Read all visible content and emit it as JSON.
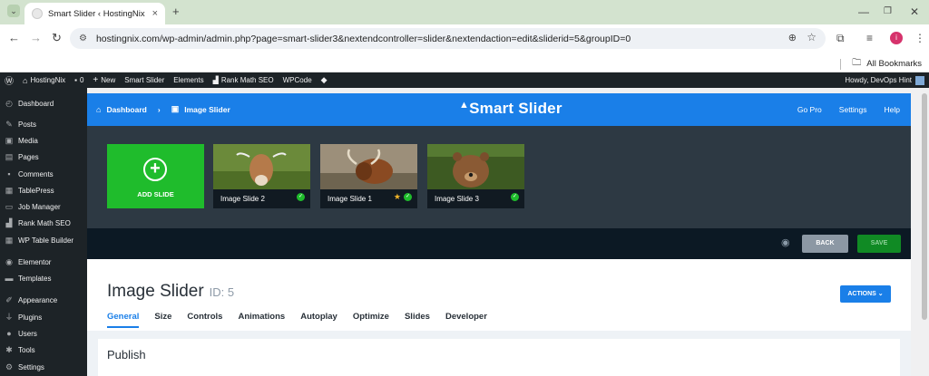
{
  "browser": {
    "tab_title": "Smart Slider ‹ HostingNix — W",
    "tab_close": "×",
    "new_tab": "+",
    "url": "hostingnix.com/wp-admin/admin.php?page=smart-slider3&nextendcontroller=slider&nextendaction=edit&sliderid=5&groupID=0",
    "bookmarks_label": "All Bookmarks",
    "profile_initial": "i"
  },
  "adminbar": {
    "site": "HostingNix",
    "comments": "0",
    "new": "New",
    "items": [
      "Smart Slider",
      "Elements",
      "Rank Math SEO",
      "WPCode"
    ],
    "howdy": "Howdy, DevOps Hint"
  },
  "sidebar": {
    "items": [
      {
        "label": "Dashboard",
        "icon": "dashboard-icon"
      },
      {
        "label": "Posts",
        "icon": "pin-icon"
      },
      {
        "label": "Media",
        "icon": "media-icon"
      },
      {
        "label": "Pages",
        "icon": "page-icon"
      },
      {
        "label": "Comments",
        "icon": "comment-icon"
      },
      {
        "label": "TablePress",
        "icon": "table-icon"
      },
      {
        "label": "Job Manager",
        "icon": "briefcase-icon"
      },
      {
        "label": "Rank Math SEO",
        "icon": "chart-icon"
      },
      {
        "label": "WP Table Builder",
        "icon": "grid-icon"
      },
      {
        "label": "Elementor",
        "icon": "elementor-icon"
      },
      {
        "label": "Templates",
        "icon": "folder-icon"
      },
      {
        "label": "Appearance",
        "icon": "brush-icon"
      },
      {
        "label": "Plugins",
        "icon": "plug-icon"
      },
      {
        "label": "Users",
        "icon": "user-icon"
      },
      {
        "label": "Tools",
        "icon": "wrench-icon"
      },
      {
        "label": "Settings",
        "icon": "settings-icon"
      }
    ]
  },
  "smartslider": {
    "breadcrumb": {
      "home": "Dashboard",
      "current": "Image Slider"
    },
    "logo": "Smart Slider",
    "nav": [
      "Go Pro",
      "Settings",
      "Help"
    ],
    "add_slide": "ADD SLIDE",
    "slides": [
      {
        "label": "Image Slide 2",
        "starred": false
      },
      {
        "label": "Image Slide 1",
        "starred": true
      },
      {
        "label": "Image Slide 3",
        "starred": false
      }
    ],
    "back": "BACK",
    "save": "SAVE",
    "title": "Image Slider",
    "id_label": "ID: 5",
    "actions": "ACTIONS",
    "tabs": [
      "General",
      "Size",
      "Controls",
      "Animations",
      "Autoplay",
      "Optimize",
      "Slides",
      "Developer"
    ],
    "active_tab": "General",
    "section": "Publish"
  },
  "colors": {
    "brand_blue": "#1a7fe8",
    "add_green": "#1fbc2c",
    "wp_dark": "#1d2327"
  }
}
